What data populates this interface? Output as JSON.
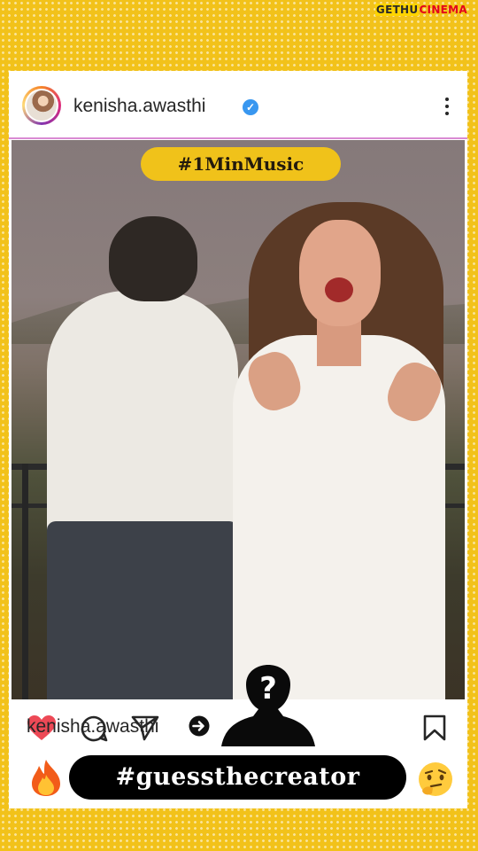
{
  "watermark": {
    "part1": "GETHU",
    "part2": "CINEMA"
  },
  "post": {
    "username": "kenisha.awasthi",
    "verified": true,
    "hashtag_top": "#1MinMusic",
    "footer_username": "kenisha.awasthi",
    "hashtag_bottom": "#guessthecreator"
  },
  "icons": {
    "header": [
      "verified-badge-icon",
      "more-options-icon"
    ],
    "actions": [
      "like-heart-icon",
      "comment-icon",
      "share-icon",
      "save-bookmark-icon"
    ],
    "footer": [
      "arrow-right-circle-icon",
      "mystery-person-silhouette-icon",
      "fire-emoji-icon",
      "thinking-face-emoji-icon"
    ]
  },
  "colors": {
    "background": "#f2c21a",
    "pill_yellow": "#f0c21a",
    "like_red": "#ed4956",
    "verified_blue": "#3897f0",
    "divider_pink": "#d98bd3"
  }
}
